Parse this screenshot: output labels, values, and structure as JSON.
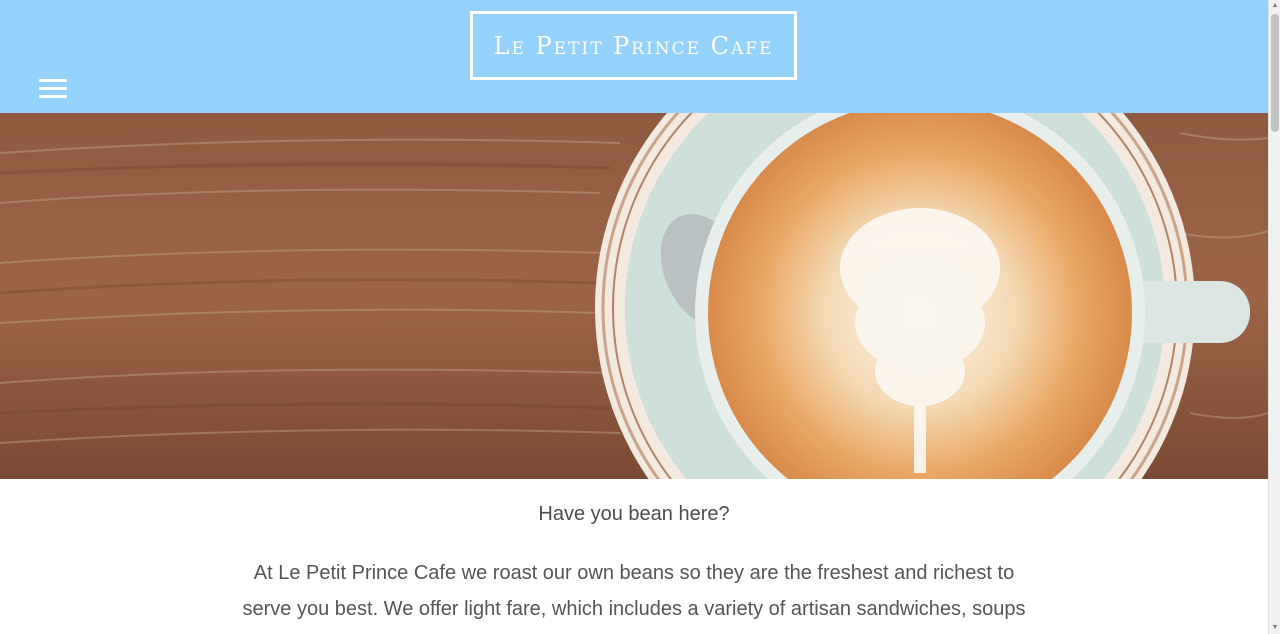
{
  "header": {
    "logo_text": "Le Petit Prince Cafe",
    "menu_icon": "hamburger-menu-icon"
  },
  "hero": {
    "image": "latte-art-coffee-cup-on-wooden-table"
  },
  "content": {
    "tagline": "Have you bean here?",
    "intro": "At Le Petit Prince Cafe we roast our own beans so they are the freshest and richest to serve you best. We offer light fare, which includes a variety of artisan sandwiches, soups"
  },
  "scrollbar": {
    "up_icon": "arrow-up-icon",
    "down_icon": "arrow-down-icon"
  },
  "colors": {
    "header_bg": "#94d1fb",
    "logo": "#ffffff",
    "text": "#555555"
  }
}
